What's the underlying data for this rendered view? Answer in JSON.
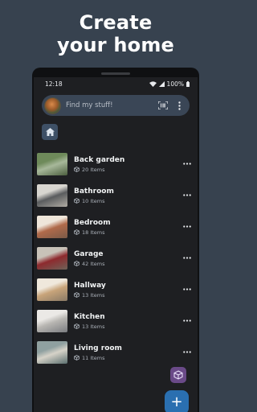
{
  "promo": {
    "line1": "Create",
    "line2": "your home"
  },
  "statusbar": {
    "time": "12:18",
    "battery": "100%"
  },
  "search": {
    "placeholder": "Find my stuff!"
  },
  "rooms": [
    {
      "name": "Back garden",
      "count": "20 Items",
      "thumb": [
        "#6e8a5a",
        "#a7b89a",
        "#4b5e3e"
      ]
    },
    {
      "name": "Bathroom",
      "count": "10 Items",
      "thumb": [
        "#d8d6d0",
        "#5a5c5e",
        "#b0aca4"
      ]
    },
    {
      "name": "Bedroom",
      "count": "18 Items",
      "thumb": [
        "#efe6da",
        "#b06a4a",
        "#7a5a48"
      ]
    },
    {
      "name": "Garage",
      "count": "42 Items",
      "thumb": [
        "#c8c2b8",
        "#8e2a2e",
        "#6e6258"
      ]
    },
    {
      "name": "Hallway",
      "count": "13 Items",
      "thumb": [
        "#efe8dc",
        "#c8a47a",
        "#8a7a66"
      ]
    },
    {
      "name": "Kitchen",
      "count": "13 Items",
      "thumb": [
        "#ebe9e6",
        "#b8b6b2",
        "#7a7c80"
      ]
    },
    {
      "name": "Living room",
      "count": "11 Items",
      "thumb": [
        "#8fa0a0",
        "#d6d2c8",
        "#5a6e6e"
      ]
    }
  ],
  "colors": {
    "background": "#37424f",
    "screen": "#1e1f22",
    "searchbar": "#3a4656",
    "fab": "#2a6fb0",
    "fab_small": "#6a4a88"
  },
  "fab": {
    "label": "+"
  }
}
